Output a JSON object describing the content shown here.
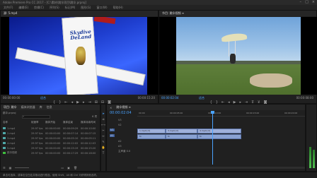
{
  "window_title": "Adobe Premiere Pro CC 2017 - [C:\\素材\\跳伞项目\\跳伞.prproj]",
  "menu": [
    "文件(F)",
    "编辑(E)",
    "剪辑(C)",
    "序列(S)",
    "标记(M)",
    "图形(G)",
    "窗口(W)",
    "帮助(H)"
  ],
  "source_monitor": {
    "tab": "源: 5.mp4",
    "plane_text_line1": "Skydive",
    "plane_text_line2": "DeLand",
    "timecode_left": "00:00:00:00",
    "fit_label": "适合",
    "timecode_right": "00:00:15:20"
  },
  "program_monitor": {
    "tab": "节目: 跳伞视频 ≡",
    "timecode_left": "00:00:02:04",
    "fit_label": "适合",
    "timecode_right": "00:00:08:00"
  },
  "transport_icons": [
    "mark-in",
    "mark-out",
    "go-to-in",
    "step-back",
    "play",
    "step-forward",
    "go-to-out",
    "insert",
    "overwrite",
    "export-frame"
  ],
  "project_panel": {
    "tabs": [
      "项目: 跳伞",
      "媒体浏览器",
      "库",
      "信息"
    ],
    "project_file": "跳伞.prproj",
    "item_count": "6 项",
    "columns": [
      "名称",
      "帧速率",
      "媒体开始",
      "媒体结束",
      "媒体持续时间"
    ],
    "items": [
      {
        "name": "1.mp4",
        "color": "#4fa8a8",
        "fps": "29.97 fps",
        "start": "00:00:00:00",
        "end": "00:00:09:29",
        "dur": "00:00:10:00"
      },
      {
        "name": "2.mp4",
        "color": "#4fa8a8",
        "fps": "29.97 fps",
        "start": "00:00:00:00",
        "end": "00:00:07:14",
        "dur": "00:00:07:15"
      },
      {
        "name": "3.mp4",
        "color": "#4fa8a8",
        "fps": "29.97 fps",
        "start": "00:00:00:00",
        "end": "00:00:05:10",
        "dur": "00:00:05:11"
      },
      {
        "name": "4.mp4",
        "color": "#4fa8a8",
        "fps": "29.97 fps",
        "start": "00:00:00:00",
        "end": "00:00:12:02",
        "dur": "00:00:12:03"
      },
      {
        "name": "5.mp4",
        "color": "#4fa8a8",
        "fps": "29.97 fps",
        "start": "00:00:00:00",
        "end": "00:00:15:19",
        "dur": "00:00:15:20"
      },
      {
        "name": "跳伞视频",
        "color": "#3fbf3f",
        "fps": "29.97 fps",
        "start": "00:00:00:00",
        "end": "00:00:17:29",
        "dur": "00:00:18:00"
      }
    ]
  },
  "timeline": {
    "tab": "跳伞视频 ≡",
    "timecode": "00:00:02:04",
    "ruler_labels": [
      "00:00",
      "00:00:05:00",
      "00:00:10:00",
      "00:00:15:00",
      "00:00:20:00"
    ],
    "tracks": [
      "V3",
      "V2",
      "V1",
      "A1",
      "A2",
      "A3",
      "主声道"
    ],
    "master_value": "0.0",
    "video_clips": [
      "1.mp4 [V]",
      "3.mp4 [V]",
      "4.mp4 [V]"
    ],
    "audio_clips": [
      "fx",
      "fx",
      "fx"
    ]
  },
  "status_bar": "单击可选择，或单击空白处并拖动进行框选。使用 Shift、Alt 和 Ctrl 可获得其他选项。",
  "colors": {
    "accent_blue": "#4aa3ff",
    "clip_blue": "#8aa2d2",
    "playhead": "#4aa3ff"
  }
}
